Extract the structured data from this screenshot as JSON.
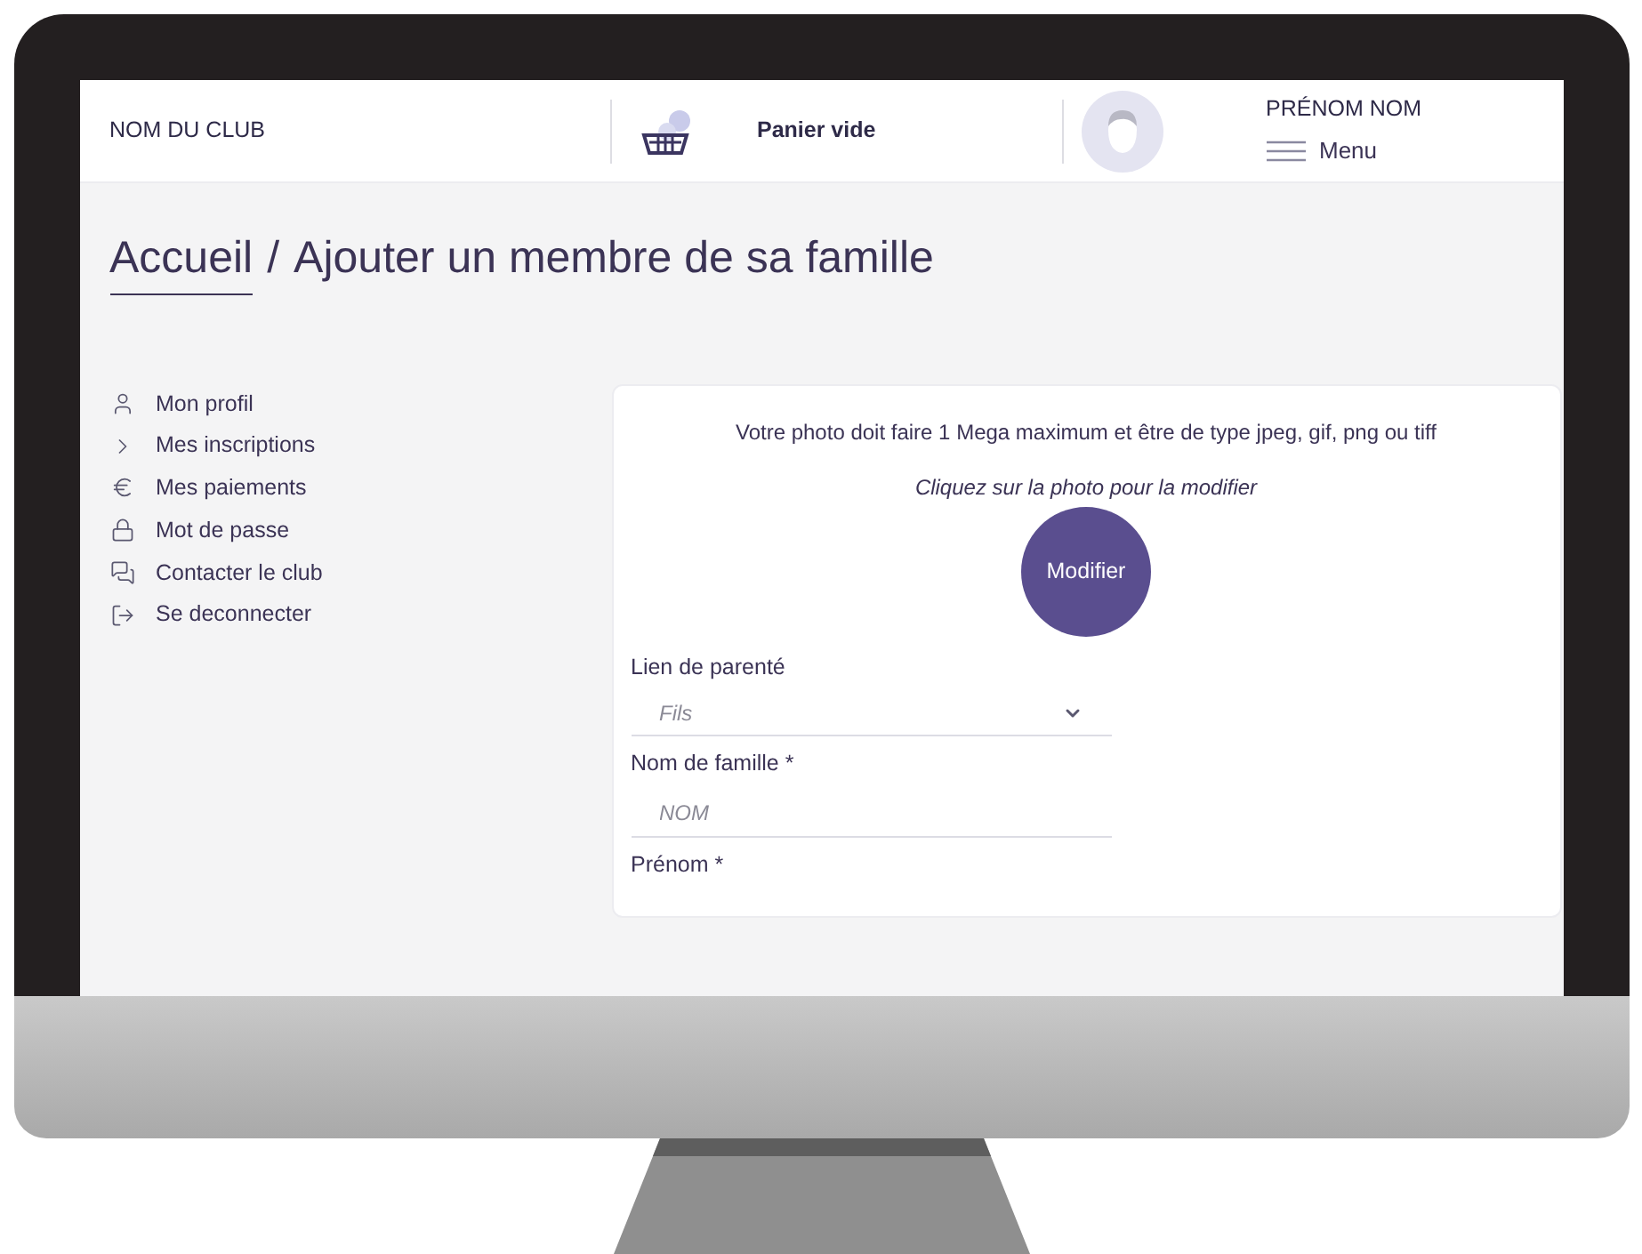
{
  "header": {
    "club_name": "NOM DU CLUB",
    "cart_label": "Panier vide",
    "user_name": "PRÉNOM NOM",
    "menu_label": "Menu"
  },
  "breadcrumb": {
    "home": "Accueil",
    "separator": "/",
    "current": "Ajouter un membre de sa famille"
  },
  "sidebar": {
    "items": [
      {
        "label": "Mon profil"
      },
      {
        "label": "Mes inscriptions"
      },
      {
        "label": "Mes paiements"
      },
      {
        "label": "Mot de passe"
      },
      {
        "label": "Contacter le club"
      },
      {
        "label": "Se deconnecter"
      }
    ]
  },
  "photo": {
    "hint": "Votre photo doit faire 1 Mega maximum et être de type jpeg, gif, png ou tiff",
    "instruction": "Cliquez sur la photo pour la modifier",
    "button": "Modifier"
  },
  "form": {
    "fields": [
      {
        "kind": "select",
        "label": "Lien de parenté",
        "placeholder": "Fils"
      },
      {
        "kind": "text",
        "label": "Nom de famille *",
        "placeholder": "NOM"
      },
      {
        "kind": "text",
        "label": "Prénom *"
      }
    ]
  }
}
